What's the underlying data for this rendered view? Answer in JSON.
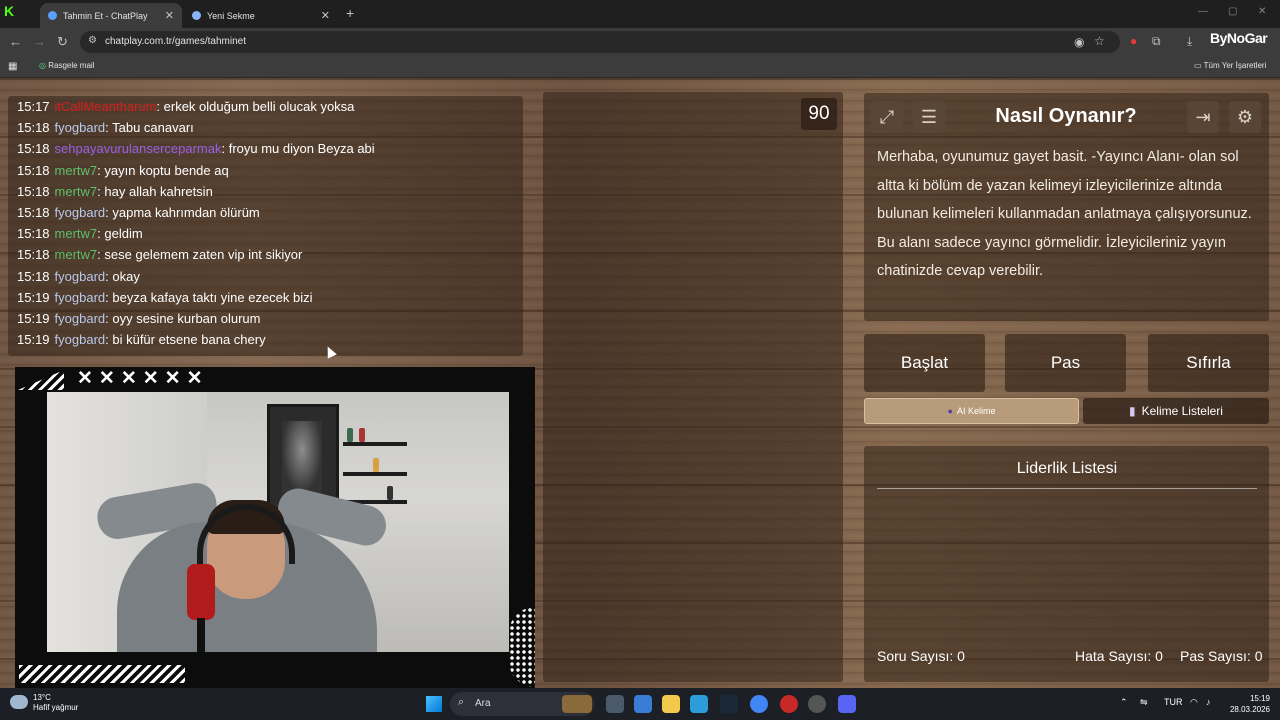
{
  "browser": {
    "tabs": [
      {
        "title": "Tahmin Et - ChatPlay",
        "active": true
      },
      {
        "title": "Yeni Sekme",
        "active": false
      }
    ],
    "url": "chatplay.com.tr/games/tahminet",
    "bookmarks": {
      "left": "Rasgele mail",
      "right": "Tüm Yer İşaretleri"
    },
    "brand_main": "ByNo",
    "brand_tail": "Gar"
  },
  "chat": {
    "messages": [
      {
        "time": "15:17",
        "user": "itCallMeantharum",
        "color": "#d41f1f",
        "text": ": erkek olduğum belli olucak yoksa"
      },
      {
        "time": "15:18",
        "user": "fyogbard",
        "color": "#b9c9ea",
        "text": ": Tabu canavarı"
      },
      {
        "time": "15:18",
        "user": "sehpayavurulanserceparmak",
        "color": "#9b5de5",
        "text": ": froyu mu diyon Beyza abi"
      },
      {
        "time": "15:18",
        "user": "mertw7",
        "color": "#5fbf6b",
        "text": ": yayın koptu bende aq"
      },
      {
        "time": "15:18",
        "user": "mertw7",
        "color": "#5fbf6b",
        "text": ": hay allah kahretsin"
      },
      {
        "time": "15:18",
        "user": "fyogbard",
        "color": "#b9c9ea",
        "text": ": yapma kahrımdan ölürüm"
      },
      {
        "time": "15:18",
        "user": "mertw7",
        "color": "#5fbf6b",
        "text": ": geldim"
      },
      {
        "time": "15:18",
        "user": "mertw7",
        "color": "#5fbf6b",
        "text": ": sese gelemem zaten vip int sikiyor"
      },
      {
        "time": "15:18",
        "user": "fyogbard",
        "color": "#b9c9ea",
        "text": ": okay"
      },
      {
        "time": "15:19",
        "user": "fyogbard",
        "color": "#b9c9ea",
        "text": ": beyza kafaya taktı yine ezecek bizi"
      },
      {
        "time": "15:19",
        "user": "fyogbard",
        "color": "#b9c9ea",
        "text": ": oyy sesine kurban olurum"
      },
      {
        "time": "15:19",
        "user": "fyogbard",
        "color": "#b9c9ea",
        "text": ": bi küfür etsene bana chery"
      }
    ]
  },
  "timer": "90",
  "howto": {
    "title": "Nasıl Oynanır?",
    "text": "Merhaba, oyunumuz gayet basit. -Yayıncı Alanı- olan sol altta ki bölüm de yazan kelimeyi izleyicilerinize altında bulunan kelimeleri kullanmadan anlatmaya çalışıyorsunuz. Bu alanı sadece yayıncı görmelidir. İzleyicileriniz yayın chatinizde cevap verebilir."
  },
  "buttons": {
    "start": "Başlat",
    "pass": "Pas",
    "reset": "Sıfırla"
  },
  "tabs": {
    "ai": "AI Kelime",
    "lists": "Kelime Listeleri"
  },
  "leaderboard": {
    "title": "Liderlik Listesi"
  },
  "stats": {
    "questions": "Soru Sayısı: 0",
    "errors": "Hata Sayısı: 0",
    "passes": "Pas Sayısı: 0"
  },
  "overlay": {
    "marks": "✕✕✕✕✕✕"
  },
  "taskbar": {
    "temp": "13°C",
    "weather": "Hafif yağmur",
    "search": "Ara",
    "lang": "TUR",
    "time": "15:19",
    "date": "28.03.2026"
  }
}
